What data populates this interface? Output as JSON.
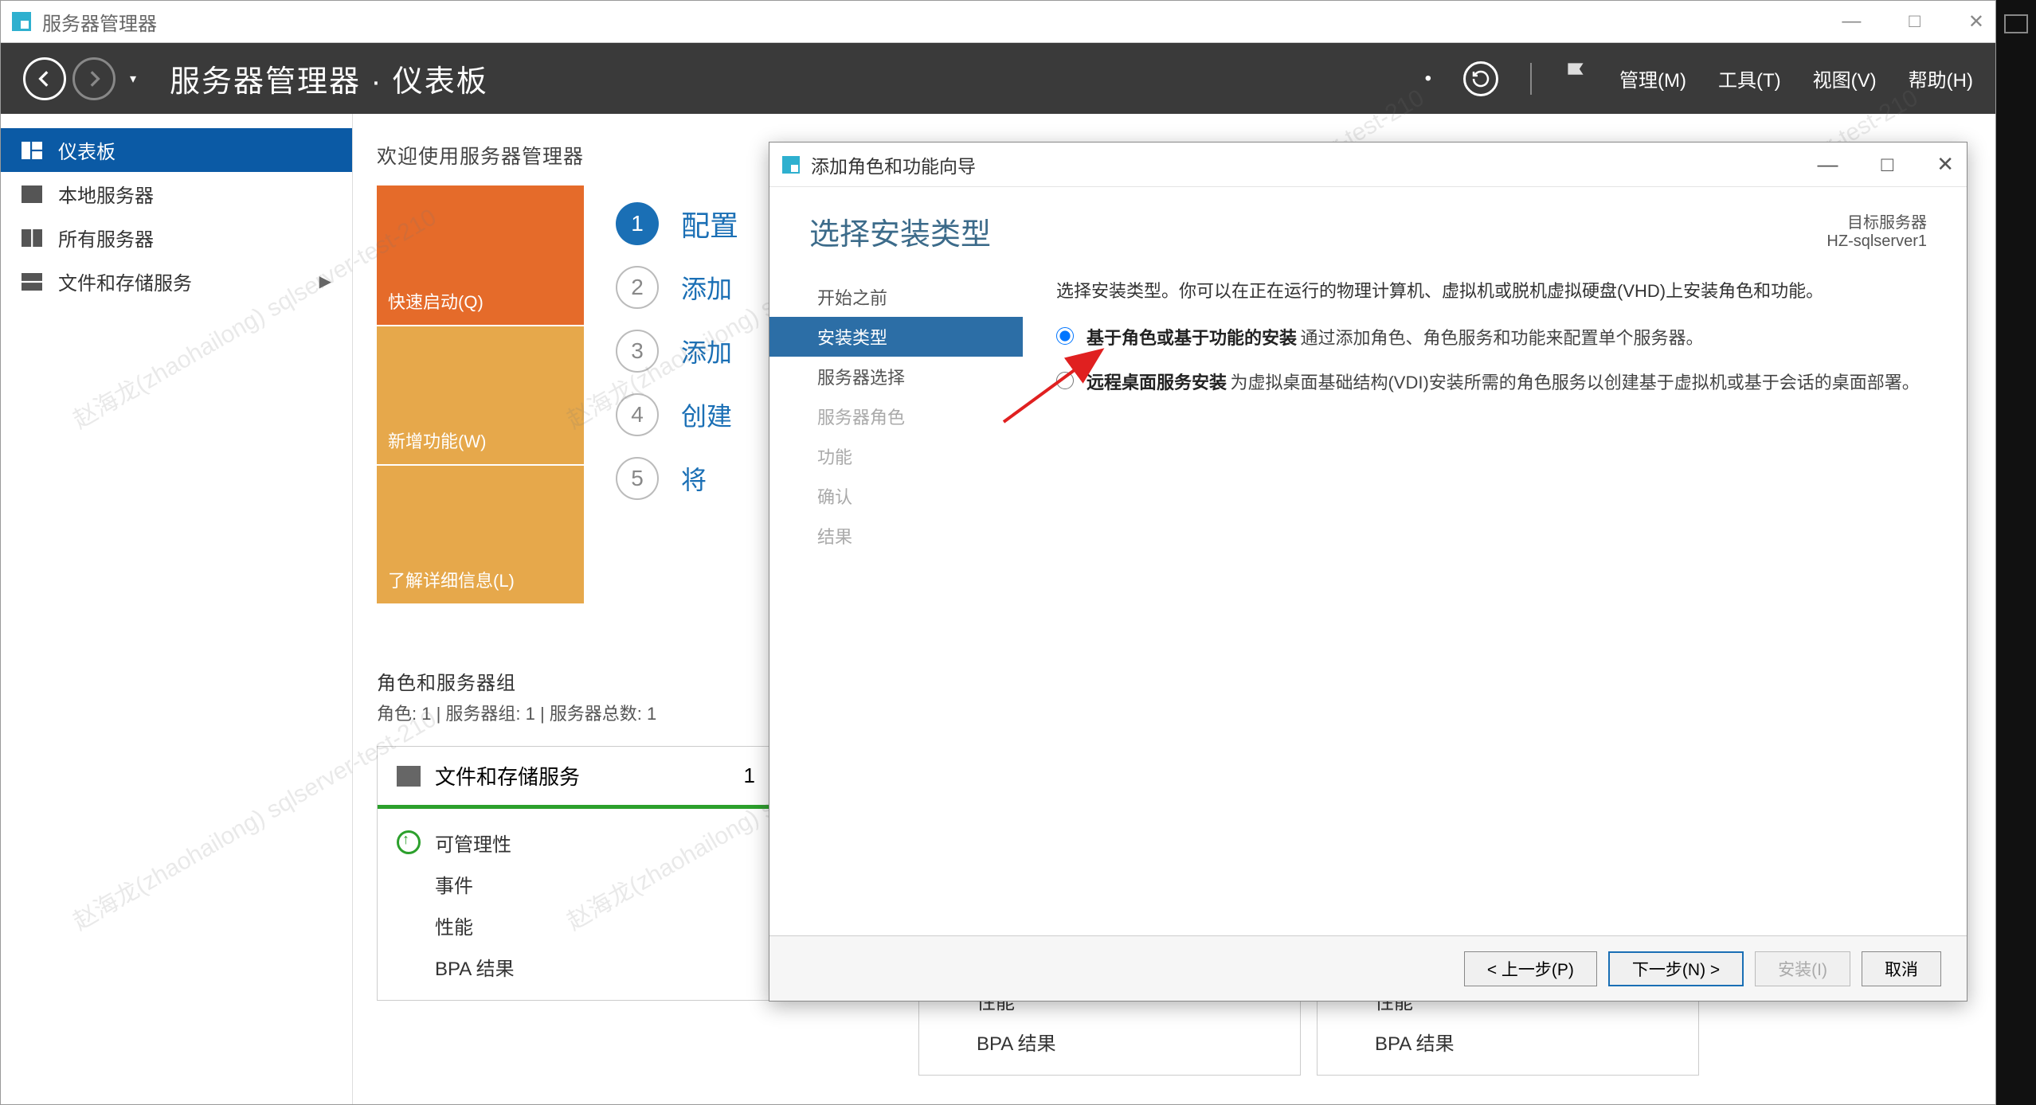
{
  "outer": {
    "title": "服务器管理器",
    "minimize": "—",
    "maximize": "□",
    "close": "✕"
  },
  "darkbar": {
    "breadcrumb": "服务器管理器 · 仪表板",
    "menu_manage": "管理(M)",
    "menu_tools": "工具(T)",
    "menu_view": "视图(V)",
    "menu_help": "帮助(H)"
  },
  "sidebar": {
    "items": [
      {
        "label": "仪表板"
      },
      {
        "label": "本地服务器"
      },
      {
        "label": "所有服务器"
      },
      {
        "label": "文件和存储服务"
      }
    ]
  },
  "dash": {
    "welcome": "欢迎使用服务器管理器",
    "tile_quick": "快速启动(Q)",
    "tile_new": "新增功能(W)",
    "tile_learn": "了解详细信息(L)",
    "steps": [
      {
        "n": "1",
        "label": "配置"
      },
      {
        "n": "2",
        "label": "添加"
      },
      {
        "n": "3",
        "label": "添加"
      },
      {
        "n": "4",
        "label": "创建"
      },
      {
        "n": "5",
        "label": "将"
      }
    ]
  },
  "roles": {
    "header": "角色和服务器组",
    "sub": "角色: 1 | 服务器组: 1 | 服务器总数: 1",
    "card1": {
      "title": "文件和存储服务",
      "count": "1",
      "rows": [
        "可管理性",
        "事件",
        "性能",
        "BPA 结果"
      ]
    },
    "card2": {
      "rows": [
        "性能",
        "BPA 结果"
      ]
    },
    "card3": {
      "rows": [
        "性能",
        "BPA 结果"
      ]
    }
  },
  "wizard": {
    "title": "添加角色和功能向导",
    "minimize": "—",
    "maximize": "□",
    "close": "✕",
    "heading": "选择安装类型",
    "target_label": "目标服务器",
    "target_name": "HZ-sqlserver1",
    "nav": [
      {
        "label": "开始之前",
        "state": "done"
      },
      {
        "label": "安装类型",
        "state": "active"
      },
      {
        "label": "服务器选择",
        "state": "next"
      },
      {
        "label": "服务器角色",
        "state": "disabled"
      },
      {
        "label": "功能",
        "state": "disabled"
      },
      {
        "label": "确认",
        "state": "disabled"
      },
      {
        "label": "结果",
        "state": "disabled"
      }
    ],
    "intro": "选择安装类型。你可以在正在运行的物理计算机、虚拟机或脱机虚拟硬盘(VHD)上安装角色和功能。",
    "opts": [
      {
        "title": "基于角色或基于功能的安装",
        "desc": "通过添加角色、角色服务和功能来配置单个服务器。",
        "checked": true
      },
      {
        "title": "远程桌面服务安装",
        "desc": "为虚拟桌面基础结构(VDI)安装所需的角色服务以创建基于虚拟机或基于会话的桌面部署。",
        "checked": false
      }
    ],
    "btn_prev": "< 上一步(P)",
    "btn_next": "下一步(N) >",
    "btn_install": "安装(I)",
    "btn_cancel": "取消"
  },
  "watermark": "赵海龙(zhaohailong)\nsqlserver-test-210"
}
